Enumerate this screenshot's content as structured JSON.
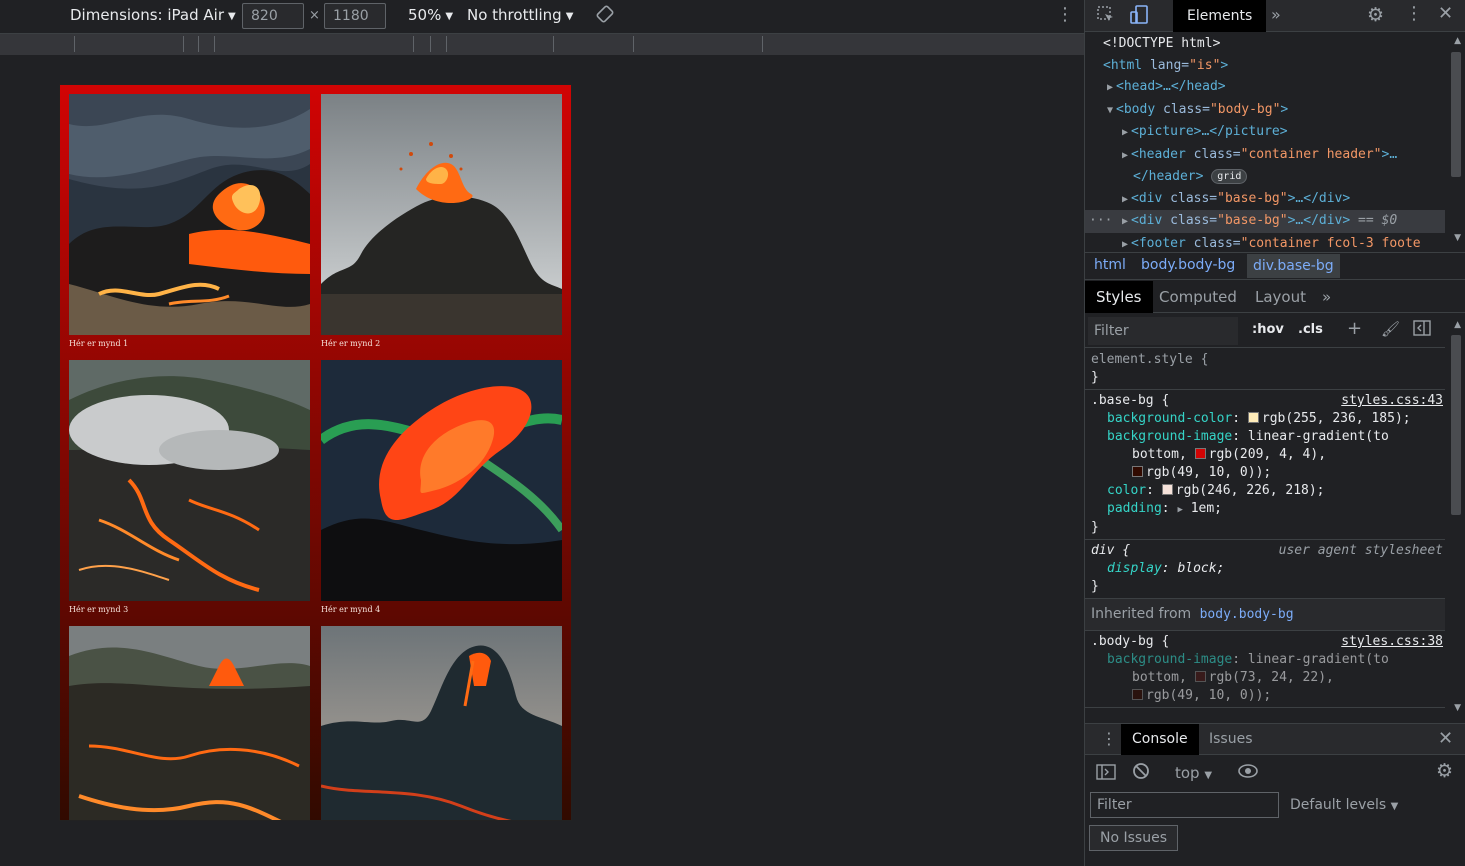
{
  "toolbar": {
    "dimensions_label": "Dimensions: iPad Air",
    "width_value": "820",
    "times": "×",
    "height_value": "1180",
    "zoom": "50%",
    "throttling": "No throttling"
  },
  "page": {
    "captions": [
      "Hér er mynd 1",
      "Hér er mynd 2",
      "Hér er mynd 3",
      "Hér er mynd 4"
    ]
  },
  "devtools": {
    "tabs": {
      "elements": "Elements"
    },
    "dom": {
      "l1": "<!DOCTYPE html>",
      "l2_tag": "<html ",
      "l2_attr": "lang=",
      "l2_val": "\"is\"",
      "l2_end": ">",
      "l3": "<head>…</head>",
      "l4_tag": "<body ",
      "l4_attr": "class=",
      "l4_val": "\"body-bg\"",
      "l4_end": ">",
      "l5": "<picture>…</picture>",
      "l6_tag": "<header ",
      "l6_attr": "class=",
      "l6_val": "\"container header\"",
      "l6_end": ">…",
      "l7": "</header>",
      "l7_badge": "grid",
      "l8_tag": "<div ",
      "l8_attr": "class=",
      "l8_val": "\"base-bg\"",
      "l8_end": ">…</div>",
      "l9_tag": "<div ",
      "l9_attr": "class=",
      "l9_val": "\"base-bg\"",
      "l9_end": ">…</div>",
      "l9_eq": " == $0",
      "l10_tag": "<footer ",
      "l10_attr": "class=",
      "l10_val": "\"container fcol-3 foote"
    },
    "breadcrumbs": [
      "html",
      "body.body-bg",
      "div.base-bg"
    ],
    "subtabs": {
      "styles": "Styles",
      "computed": "Computed",
      "layout": "Layout"
    },
    "filter": {
      "placeholder": "Filter",
      "hov": ":hov",
      "cls": ".cls"
    },
    "styles": {
      "element_style": "element.style {",
      "close": "}",
      "base_selector": ".base-bg {",
      "base_src": "styles.css:43",
      "p1_name": "background-color",
      "p1_val": "rgb(255, 236, 185);",
      "p2_name": "background-image",
      "p2_val": "linear-gradient(to",
      "p2_l2": "bottom,",
      "p2_l2b": "rgb(209, 4, 4),",
      "p2_l3": "rgb(49, 10, 0));",
      "p3_name": "color",
      "p3_val": "rgb(246, 226, 218);",
      "p4_name": "padding",
      "p4_val": "1em;",
      "div_selector": "div {",
      "ua": "user agent stylesheet",
      "div_prop": "display",
      "div_val": "block;",
      "inherited_label": "Inherited from",
      "inherited_from": "body.body-bg",
      "body_selector": ".body-bg {",
      "body_src": "styles.css:38",
      "b1_name": "background-image",
      "b1_val": "linear-gradient(to",
      "b1_l2": "bottom,",
      "b1_l2b": "rgb(73, 24, 22),",
      "b1_l3": "rgb(49, 10, 0));"
    },
    "console": {
      "tab": "Console",
      "issues": "Issues",
      "context": "top",
      "filter_placeholder": "Filter",
      "levels": "Default levels",
      "no_issues": "No Issues"
    }
  },
  "colors": {
    "swatch1": "#ffecb9",
    "swatch2": "#d10404",
    "swatch3": "#310a00",
    "swatch4": "#f6e2da",
    "swatch5": "#491816"
  }
}
